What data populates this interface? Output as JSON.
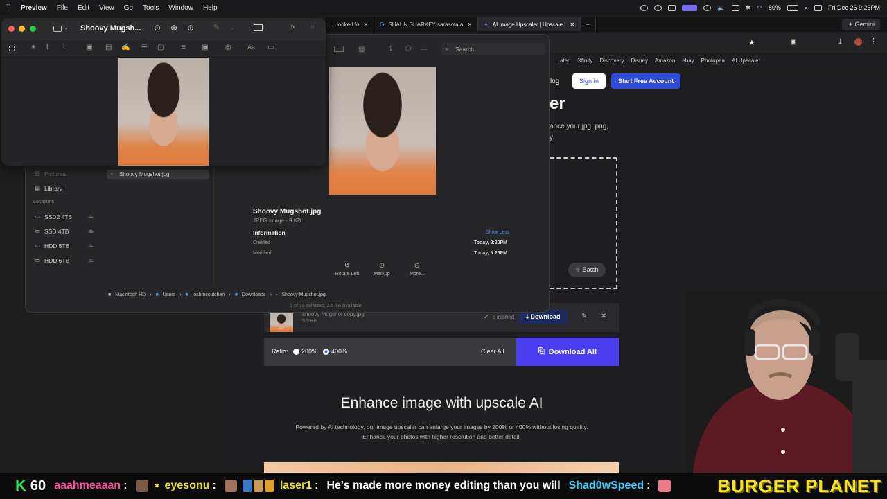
{
  "menubar": {
    "app": "Preview",
    "items": [
      "File",
      "Edit",
      "View",
      "Go",
      "Tools",
      "Window",
      "Help"
    ],
    "battery": "80%",
    "clock": "Fri Dec 26  9:26PM"
  },
  "browser": {
    "tabs": [
      {
        "label": "…looked fo"
      },
      {
        "label": "SHAUN SHARKEY sarasota a"
      },
      {
        "label": "AI Image Upscaler | Upscale I"
      }
    ],
    "gemini_label": "Gemini",
    "search_placeholder": "Search",
    "bookmarks": [
      "…ated",
      "Xfinity",
      "Discovery",
      "Disney",
      "Amazon",
      "ebay",
      "Photopea",
      "AI Upscaler"
    ]
  },
  "site": {
    "nav_partial": "log",
    "sign_in": "Sign In",
    "start_free": "Start Free Account",
    "title_partial": "er",
    "intro_partial_1": "ance your jpg, png,",
    "intro_partial_2": "y.",
    "batch_label": "Batch",
    "file_name_partial": "shoovy Mugshot copy.jpg",
    "file_size": "9.9 KB",
    "file_status": "Finished",
    "download_label": "Download",
    "ratio_label": "Ratio:",
    "ratio_options": [
      "200%",
      "400%"
    ],
    "ratio_selected": "400%",
    "clear_all": "Clear All",
    "download_all": "Download All",
    "headline": "Enhance image with upscale AI",
    "subtext": "Powered by AI technology, our image upscaler can enlarge your images by 200% or 400% without losing quality. Enhance your photos with higher resolution and better detail."
  },
  "finder": {
    "sidebar": {
      "top_partial": "Pictures",
      "library": "Library",
      "locations_header": "Locations",
      "locations": [
        "SSD2 4TB",
        "SSD 4TB",
        "HDD 5TB",
        "HDD 6TB"
      ]
    },
    "selected_file": "Shoovy Mugshot.jpg",
    "search_placeholder": "Search",
    "preview": {
      "name": "Shoovy Mugshot.jpg",
      "kind": "JPEG image - 9 KB",
      "info_header": "Information",
      "show_less": "Show Less",
      "created_label": "Created",
      "created_value": "Today, 9:20PM",
      "modified_label": "Modified",
      "modified_value": "Today, 9:25PM",
      "actions": [
        "Rotate Left",
        "Markup",
        "More..."
      ]
    },
    "path": [
      "Macintosh HD",
      "Users",
      "joshmccutchen",
      "Downloads",
      "Shoovy Mugshot.jpg"
    ],
    "status": "1 of 10 selected, 2.5 TB available"
  },
  "preview_window": {
    "title": "Shoovy Mugsh..."
  },
  "chat": {
    "counter_letter": "K",
    "counter": "60",
    "messages": [
      {
        "user": "aaahmeaaan",
        "color": "#ff4fa3",
        "text": ""
      },
      {
        "user": "eyesonu",
        "color": "#f2e22e",
        "text": ""
      },
      {
        "user": "laser1",
        "color": "#f2e22e",
        "text": "He's made more money editing than you will"
      },
      {
        "user": "Shad0wSpeed",
        "color": "#3ed0ff",
        "text": ""
      }
    ],
    "banner": "BURGER PLANET"
  },
  "colors": {
    "accent_blue": "#2f4bd8",
    "download_all": "#4a3ef0",
    "chat_green": "#2ee05a"
  }
}
